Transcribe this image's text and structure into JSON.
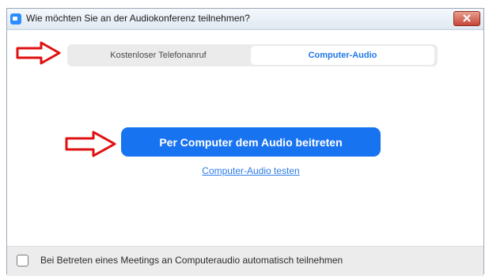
{
  "window": {
    "title": "Wie möchten Sie an der Audiokonferenz teilnehmen?"
  },
  "tabs": [
    {
      "label": "Kostenloser Telefonanruf",
      "selected": false
    },
    {
      "label": "Computer-Audio",
      "selected": true
    }
  ],
  "main": {
    "join_button_label": "Per Computer dem Audio beitreten",
    "test_link_label": "Computer-Audio testen"
  },
  "footer": {
    "auto_join_label": "Bei Betreten eines Meetings an Computeraudio automatisch teilnehmen",
    "auto_join_checked": false
  },
  "colors": {
    "accent": "#1873f0",
    "link": "#2d7be8",
    "annotation_arrow": "#e01010",
    "close_button": "#c7453a"
  },
  "icons": [
    "app-icon",
    "close-icon",
    "arrow-icon"
  ]
}
